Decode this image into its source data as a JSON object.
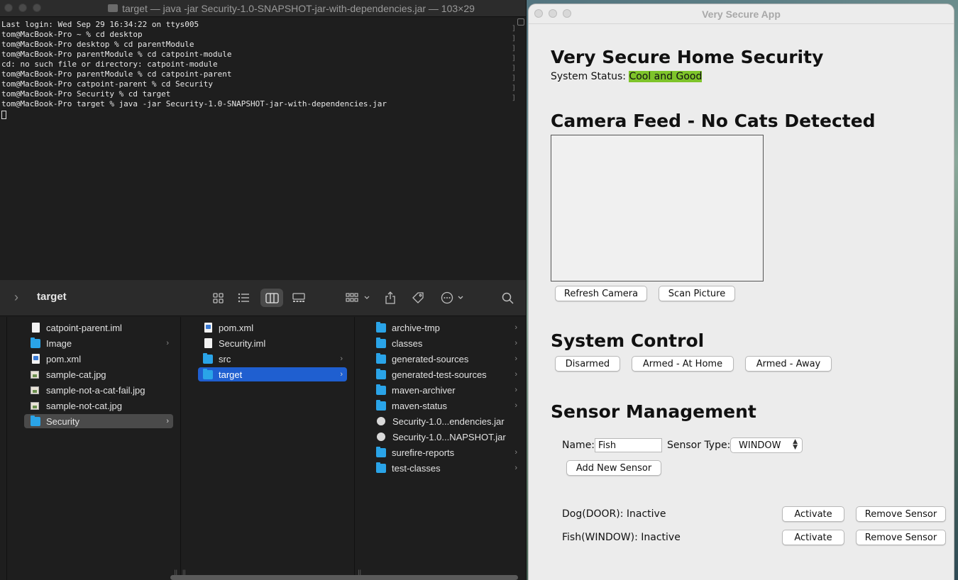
{
  "terminal": {
    "title": "target — java -jar Security-1.0-SNAPSHOT-jar-with-dependencies.jar — 103×29",
    "lines": [
      "Last login: Wed Sep 29 16:34:22 on ttys005",
      "tom@MacBook-Pro ~ % cd desktop",
      "tom@MacBook-Pro desktop % cd parentModule",
      "tom@MacBook-Pro parentModule % cd catpoint-module",
      "cd: no such file or directory: catpoint-module",
      "tom@MacBook-Pro parentModule % cd catpoint-parent",
      "tom@MacBook-Pro catpoint-parent % cd Security",
      "tom@MacBook-Pro Security % cd target",
      "tom@MacBook-Pro target % java -jar Security-1.0-SNAPSHOT-jar-with-dependencies.jar"
    ]
  },
  "finder": {
    "title": "target",
    "col1": [
      {
        "name": "catpoint-parent.iml",
        "icon": "doc-icon"
      },
      {
        "name": "Image",
        "icon": "folder-icon",
        "arrow": true
      },
      {
        "name": "pom.xml",
        "icon": "xml-icon"
      },
      {
        "name": "sample-cat.jpg",
        "icon": "image-icon"
      },
      {
        "name": "sample-not-a-cat-fail.jpg",
        "icon": "image-icon"
      },
      {
        "name": "sample-not-cat.jpg",
        "icon": "image-icon"
      },
      {
        "name": "Security",
        "icon": "folder-icon",
        "arrow": true,
        "selected": "gray"
      }
    ],
    "col2": [
      {
        "name": "pom.xml",
        "icon": "xml-icon"
      },
      {
        "name": "Security.iml",
        "icon": "doc-icon"
      },
      {
        "name": "src",
        "icon": "folder-icon",
        "arrow": true
      },
      {
        "name": "target",
        "icon": "folder-icon",
        "arrow": true,
        "selected": "blue"
      }
    ],
    "col3": [
      {
        "name": "archive-tmp",
        "icon": "folder-icon",
        "arrow": true
      },
      {
        "name": "classes",
        "icon": "folder-icon",
        "arrow": true
      },
      {
        "name": "generated-sources",
        "icon": "folder-icon",
        "arrow": true
      },
      {
        "name": "generated-test-sources",
        "icon": "folder-icon",
        "arrow": true
      },
      {
        "name": "maven-archiver",
        "icon": "folder-icon",
        "arrow": true
      },
      {
        "name": "maven-status",
        "icon": "folder-icon",
        "arrow": true
      },
      {
        "name": "Security-1.0...endencies.jar",
        "icon": "jar-icon"
      },
      {
        "name": "Security-1.0...NAPSHOT.jar",
        "icon": "jar-icon"
      },
      {
        "name": "surefire-reports",
        "icon": "folder-icon",
        "arrow": true
      },
      {
        "name": "test-classes",
        "icon": "folder-icon",
        "arrow": true
      }
    ]
  },
  "app": {
    "window_title": "Very Secure App",
    "heading": "Very Secure Home Security",
    "status_label": "System Status: ",
    "status_value": "Cool and Good",
    "status_color": "#7ec42a",
    "camera_heading": "Camera Feed - No Cats Detected",
    "refresh_label": "Refresh Camera",
    "scan_label": "Scan Picture",
    "control_heading": "System Control",
    "disarmed_label": "Disarmed",
    "armed_home_label": "Armed - At Home",
    "armed_away_label": "Armed - Away",
    "sensor_heading": "Sensor Management",
    "name_label": "Name:",
    "name_value": "Fish",
    "type_label": "Sensor Type:",
    "type_value": "WINDOW",
    "add_label": "Add New Sensor",
    "sensors": [
      {
        "label": "Dog(DOOR): Inactive",
        "activate": "Activate",
        "remove": "Remove Sensor"
      },
      {
        "label": "Fish(WINDOW): Inactive",
        "activate": "Activate",
        "remove": "Remove Sensor"
      }
    ]
  }
}
